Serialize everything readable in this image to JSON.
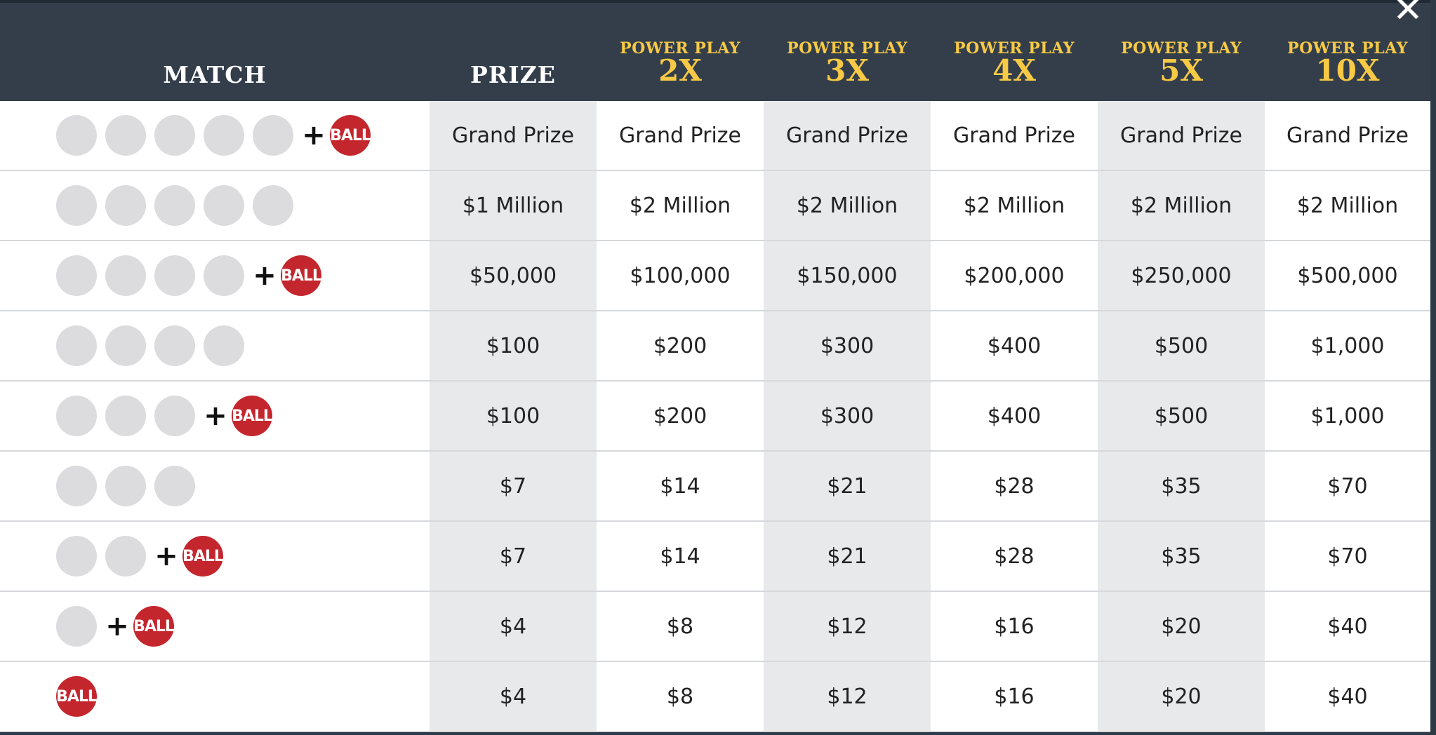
{
  "header": {
    "match_label": "MATCH",
    "prize_label": "PRIZE",
    "power_play_label": "POWER PLAY",
    "multipliers": [
      "2X",
      "3X",
      "4X",
      "5X",
      "10X"
    ]
  },
  "close_icon": "close-icon",
  "ball_label": "BALL",
  "plus_sign": "+",
  "colors": {
    "header_bg": "#333e4a",
    "accent_gold": "#f7c945",
    "power_ball_red": "#c4262e",
    "white_ball": "#dcdcde",
    "shade": "#e8e9eb"
  },
  "rows": [
    {
      "white_balls": 5,
      "power_ball": true,
      "prizes": [
        "Grand Prize",
        "Grand Prize",
        "Grand Prize",
        "Grand Prize",
        "Grand Prize",
        "Grand Prize"
      ]
    },
    {
      "white_balls": 5,
      "power_ball": false,
      "prizes": [
        "$1 Million",
        "$2 Million",
        "$2 Million",
        "$2 Million",
        "$2 Million",
        "$2 Million"
      ]
    },
    {
      "white_balls": 4,
      "power_ball": true,
      "prizes": [
        "$50,000",
        "$100,000",
        "$150,000",
        "$200,000",
        "$250,000",
        "$500,000"
      ]
    },
    {
      "white_balls": 4,
      "power_ball": false,
      "prizes": [
        "$100",
        "$200",
        "$300",
        "$400",
        "$500",
        "$1,000"
      ]
    },
    {
      "white_balls": 3,
      "power_ball": true,
      "prizes": [
        "$100",
        "$200",
        "$300",
        "$400",
        "$500",
        "$1,000"
      ]
    },
    {
      "white_balls": 3,
      "power_ball": false,
      "prizes": [
        "$7",
        "$14",
        "$21",
        "$28",
        "$35",
        "$70"
      ]
    },
    {
      "white_balls": 2,
      "power_ball": true,
      "prizes": [
        "$7",
        "$14",
        "$21",
        "$28",
        "$35",
        "$70"
      ]
    },
    {
      "white_balls": 1,
      "power_ball": true,
      "prizes": [
        "$4",
        "$8",
        "$12",
        "$16",
        "$20",
        "$40"
      ]
    },
    {
      "white_balls": 0,
      "power_ball": true,
      "prizes": [
        "$4",
        "$8",
        "$12",
        "$16",
        "$20",
        "$40"
      ]
    }
  ]
}
